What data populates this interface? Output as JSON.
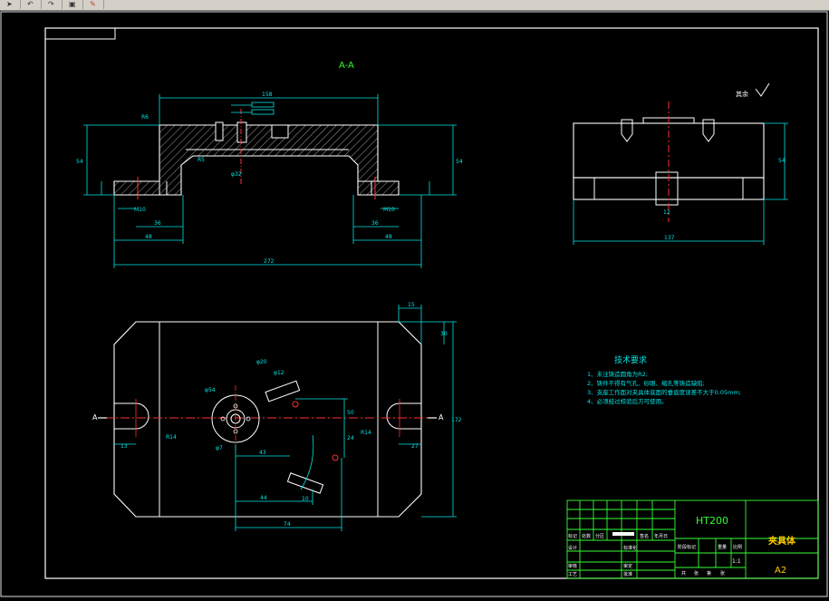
{
  "toolbar": {
    "icons": [
      "arrow-icon",
      "undo-icon",
      "redo-icon",
      "paint-icon",
      "brush-icon"
    ]
  },
  "drawing": {
    "section_title": "A-A",
    "roughness_note": "其余",
    "tech_title": "技术要求",
    "tech_items": [
      "1、未注铸造圆角为R2;",
      "2、铸件不得有气孔、砂眼、缩孔等铸造缺陷;",
      "3、支座工作面对夹具体底面的垂直度误差不大于0.05mm;",
      "4、必须经过校验后方可使用。"
    ],
    "dims": {
      "top_width": "158",
      "overall_length": "272",
      "left_48": "48",
      "right_48": "48",
      "left_36": "36",
      "right_36": "36",
      "h_54": "54",
      "h_54_right": "54",
      "r5": "R5",
      "r6": "R6",
      "w_32": "φ32",
      "m10_left": "M10",
      "m10_right": "M10",
      "side_width": "137",
      "side_h": "54",
      "side_slot": "12",
      "plan_h": "172",
      "plan_15": "15",
      "plan_30": "30",
      "plan_43": "43",
      "plan_44": "44",
      "plan_74": "74",
      "plan_phi20": "φ20",
      "plan_phi12": "φ12",
      "plan_phi54": "φ54",
      "plan_phi7": "φ7",
      "plan_r14_left": "R14",
      "plan_r14_right": "R14",
      "plan_13": "13",
      "plan_27": "27",
      "plan_50": "50",
      "plan_24": "24",
      "plan_10": "10",
      "section_mark_left": "A",
      "section_mark_right": "A"
    }
  },
  "title_block": {
    "material": "HT200",
    "part_name": "夹具体",
    "drawing_no": "A2",
    "scale": "1:1",
    "row_labels": [
      "标记",
      "处数",
      "分区",
      "更改文件号",
      "签名",
      "年月日"
    ],
    "labels2": [
      "设计",
      "审核",
      "工艺"
    ],
    "labels3": [
      "标准化",
      "审定",
      "批准"
    ],
    "stage_labels": [
      "阶段标记",
      "重量",
      "比例"
    ],
    "sheet_labels": [
      "共",
      "张",
      "第",
      "张"
    ]
  }
}
